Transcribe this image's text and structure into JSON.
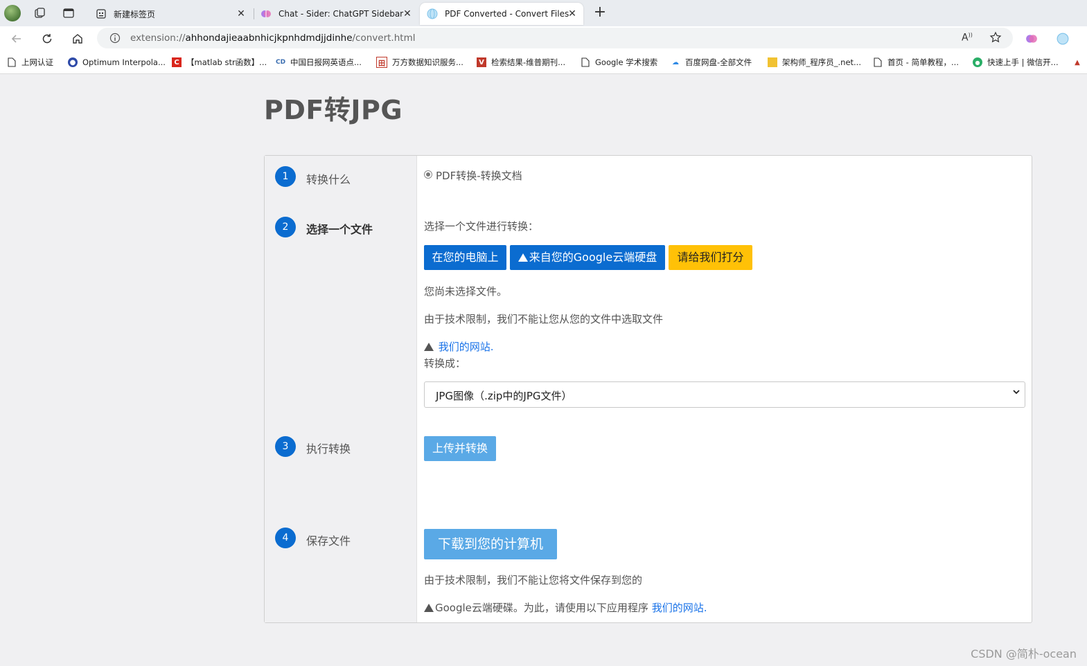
{
  "browser": {
    "tabs": [
      {
        "title": "新建标签页"
      },
      {
        "title": "Chat - Sider: ChatGPT Sidebar"
      },
      {
        "title": "PDF Converted - Convert Files"
      }
    ],
    "address": {
      "scheme": "extension://",
      "host": "ahhondajieaabnhicjkpnhdmdjjdinhe",
      "path": "/convert.html"
    },
    "bookmarks": [
      "上网认证",
      "Optimum Interpola...",
      "【matlab str函数】...",
      "中国日报网英语点...",
      "万方数据知识服务...",
      "检索结果-维普期刊...",
      "Google 学术搜索",
      "百度网盘-全部文件",
      "架构师_程序员_.net...",
      "首页 - 简单教程，...",
      "快速上手 | 微信开..."
    ]
  },
  "page": {
    "title": "PDF转JPG",
    "steps": [
      {
        "num": "1",
        "label": "转换什么"
      },
      {
        "num": "2",
        "label": "选择一个文件"
      },
      {
        "num": "3",
        "label": "执行转换"
      },
      {
        "num": "4",
        "label": "保存文件"
      }
    ],
    "step1": {
      "option": "PDF转换-转换文档"
    },
    "step2": {
      "prompt": "选择一个文件进行转换：",
      "btn_local": "在您的电脑上",
      "btn_gdrive": "来自您的Google云端硬盘",
      "btn_rate": "请给我们打分",
      "no_file": "您尚未选择文件。",
      "limit_note": "由于技术限制，我们不能让您从您的文件中选取文件",
      "site_link": "我们的网站.",
      "convert_to": "转换成：",
      "format_selected": "JPG图像（.zip中的JPG文件）"
    },
    "step3": {
      "btn": "上传并转换"
    },
    "step4": {
      "btn": "下载到您的计算机",
      "note1": "由于技术限制，我们不能让您将文件保存到您的",
      "note2": "Google云端硬碟。为此，请使用以下应用程序",
      "site_link": "我们的网站."
    }
  },
  "watermark": "CSDN @简朴-ocean",
  "colors": {
    "primary": "#0b6cd0",
    "warning": "#ffc107",
    "primary_light": "#5aa9e6",
    "link": "#1a73e8"
  }
}
